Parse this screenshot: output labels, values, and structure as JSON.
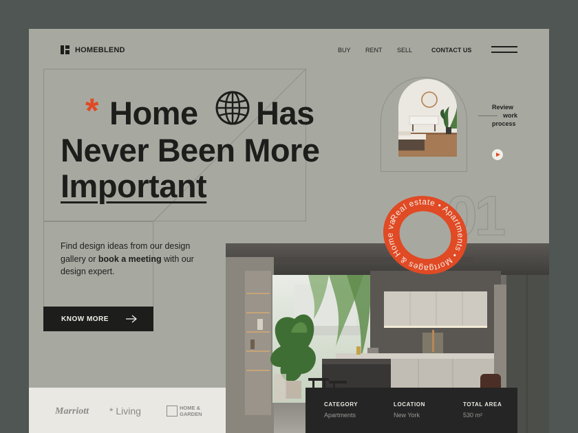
{
  "header": {
    "logo_text": "HOMEBLEND",
    "nav": [
      "BUY",
      "RENT",
      "SELL"
    ],
    "contact": "CONTACT US"
  },
  "hero": {
    "line1a": "Home",
    "line1b": "Has",
    "line2": "Never Been More",
    "line3": "Important",
    "desc_a": "Find design ideas from our design gallery or",
    "desc_b": "book a meeting",
    "desc_c": "with our design expert.",
    "cta": "KNOW MORE"
  },
  "review": {
    "l1": "Review",
    "l2": "work",
    "l3": "process"
  },
  "big_number": "01",
  "badge_text": "Real estate • Apartments • Mortgages & Home value •",
  "brands": {
    "marriott": "Marriott",
    "living": "Living",
    "hg1": "HOME &",
    "hg2": "GARDEN"
  },
  "info": {
    "category_label": "CATEGORY",
    "category_value": "Apartments",
    "location_label": "LOCATION",
    "location_value": "New York",
    "area_label": "TOTAL AREA",
    "area_value": "530 m²"
  },
  "colors": {
    "accent": "#e04a24",
    "background": "#a7a9a1",
    "dark": "#1d1d1b"
  }
}
